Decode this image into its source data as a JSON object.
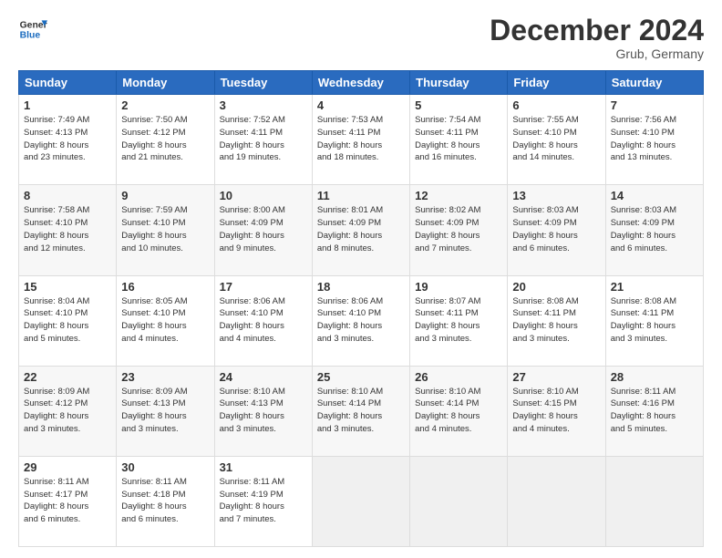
{
  "logo": {
    "line1": "General",
    "line2": "Blue"
  },
  "header": {
    "month": "December 2024",
    "location": "Grub, Germany"
  },
  "days": [
    "Sunday",
    "Monday",
    "Tuesday",
    "Wednesday",
    "Thursday",
    "Friday",
    "Saturday"
  ],
  "weeks": [
    [
      {
        "day": "1",
        "info": "Sunrise: 7:49 AM\nSunset: 4:13 PM\nDaylight: 8 hours\nand 23 minutes."
      },
      {
        "day": "2",
        "info": "Sunrise: 7:50 AM\nSunset: 4:12 PM\nDaylight: 8 hours\nand 21 minutes."
      },
      {
        "day": "3",
        "info": "Sunrise: 7:52 AM\nSunset: 4:11 PM\nDaylight: 8 hours\nand 19 minutes."
      },
      {
        "day": "4",
        "info": "Sunrise: 7:53 AM\nSunset: 4:11 PM\nDaylight: 8 hours\nand 18 minutes."
      },
      {
        "day": "5",
        "info": "Sunrise: 7:54 AM\nSunset: 4:11 PM\nDaylight: 8 hours\nand 16 minutes."
      },
      {
        "day": "6",
        "info": "Sunrise: 7:55 AM\nSunset: 4:10 PM\nDaylight: 8 hours\nand 14 minutes."
      },
      {
        "day": "7",
        "info": "Sunrise: 7:56 AM\nSunset: 4:10 PM\nDaylight: 8 hours\nand 13 minutes."
      }
    ],
    [
      {
        "day": "8",
        "info": "Sunrise: 7:58 AM\nSunset: 4:10 PM\nDaylight: 8 hours\nand 12 minutes."
      },
      {
        "day": "9",
        "info": "Sunrise: 7:59 AM\nSunset: 4:10 PM\nDaylight: 8 hours\nand 10 minutes."
      },
      {
        "day": "10",
        "info": "Sunrise: 8:00 AM\nSunset: 4:09 PM\nDaylight: 8 hours\nand 9 minutes."
      },
      {
        "day": "11",
        "info": "Sunrise: 8:01 AM\nSunset: 4:09 PM\nDaylight: 8 hours\nand 8 minutes."
      },
      {
        "day": "12",
        "info": "Sunrise: 8:02 AM\nSunset: 4:09 PM\nDaylight: 8 hours\nand 7 minutes."
      },
      {
        "day": "13",
        "info": "Sunrise: 8:03 AM\nSunset: 4:09 PM\nDaylight: 8 hours\nand 6 minutes."
      },
      {
        "day": "14",
        "info": "Sunrise: 8:03 AM\nSunset: 4:09 PM\nDaylight: 8 hours\nand 6 minutes."
      }
    ],
    [
      {
        "day": "15",
        "info": "Sunrise: 8:04 AM\nSunset: 4:10 PM\nDaylight: 8 hours\nand 5 minutes."
      },
      {
        "day": "16",
        "info": "Sunrise: 8:05 AM\nSunset: 4:10 PM\nDaylight: 8 hours\nand 4 minutes."
      },
      {
        "day": "17",
        "info": "Sunrise: 8:06 AM\nSunset: 4:10 PM\nDaylight: 8 hours\nand 4 minutes."
      },
      {
        "day": "18",
        "info": "Sunrise: 8:06 AM\nSunset: 4:10 PM\nDaylight: 8 hours\nand 3 minutes."
      },
      {
        "day": "19",
        "info": "Sunrise: 8:07 AM\nSunset: 4:11 PM\nDaylight: 8 hours\nand 3 minutes."
      },
      {
        "day": "20",
        "info": "Sunrise: 8:08 AM\nSunset: 4:11 PM\nDaylight: 8 hours\nand 3 minutes."
      },
      {
        "day": "21",
        "info": "Sunrise: 8:08 AM\nSunset: 4:11 PM\nDaylight: 8 hours\nand 3 minutes."
      }
    ],
    [
      {
        "day": "22",
        "info": "Sunrise: 8:09 AM\nSunset: 4:12 PM\nDaylight: 8 hours\nand 3 minutes."
      },
      {
        "day": "23",
        "info": "Sunrise: 8:09 AM\nSunset: 4:13 PM\nDaylight: 8 hours\nand 3 minutes."
      },
      {
        "day": "24",
        "info": "Sunrise: 8:10 AM\nSunset: 4:13 PM\nDaylight: 8 hours\nand 3 minutes."
      },
      {
        "day": "25",
        "info": "Sunrise: 8:10 AM\nSunset: 4:14 PM\nDaylight: 8 hours\nand 3 minutes."
      },
      {
        "day": "26",
        "info": "Sunrise: 8:10 AM\nSunset: 4:14 PM\nDaylight: 8 hours\nand 4 minutes."
      },
      {
        "day": "27",
        "info": "Sunrise: 8:10 AM\nSunset: 4:15 PM\nDaylight: 8 hours\nand 4 minutes."
      },
      {
        "day": "28",
        "info": "Sunrise: 8:11 AM\nSunset: 4:16 PM\nDaylight: 8 hours\nand 5 minutes."
      }
    ],
    [
      {
        "day": "29",
        "info": "Sunrise: 8:11 AM\nSunset: 4:17 PM\nDaylight: 8 hours\nand 6 minutes."
      },
      {
        "day": "30",
        "info": "Sunrise: 8:11 AM\nSunset: 4:18 PM\nDaylight: 8 hours\nand 6 minutes."
      },
      {
        "day": "31",
        "info": "Sunrise: 8:11 AM\nSunset: 4:19 PM\nDaylight: 8 hours\nand 7 minutes."
      },
      null,
      null,
      null,
      null
    ]
  ]
}
